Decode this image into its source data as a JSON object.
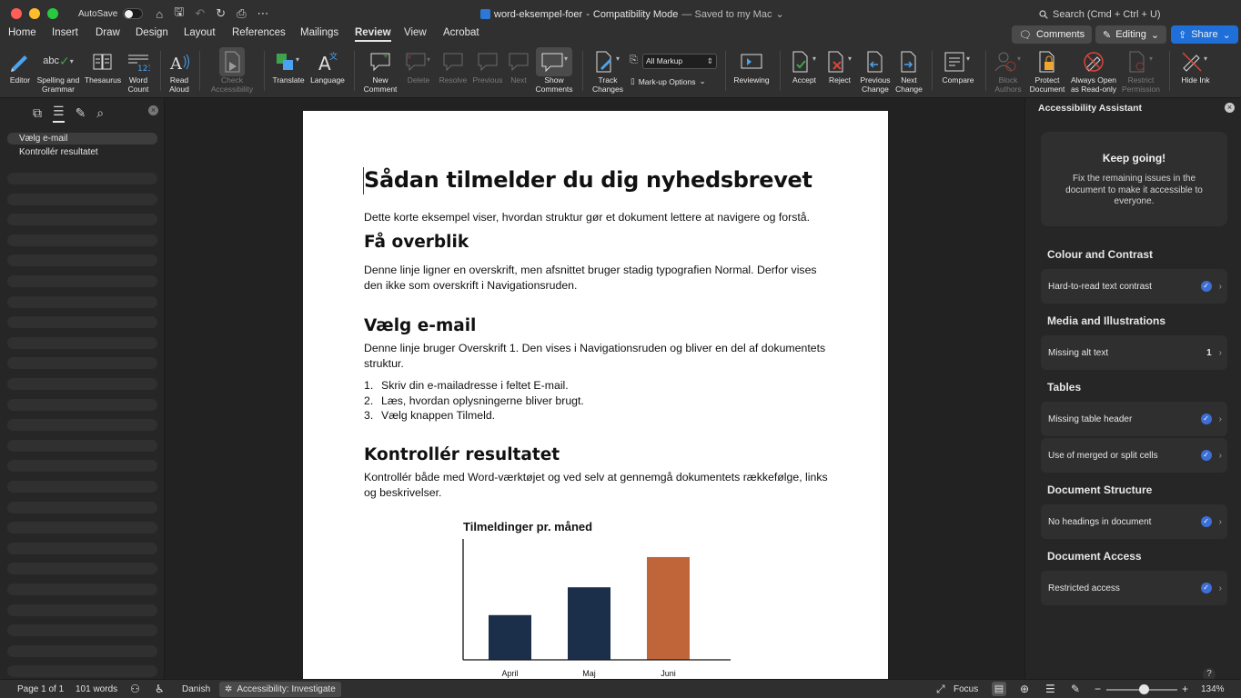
{
  "window": {
    "autosave_label": "AutoSave",
    "doc_name": "word-eksempel-foer",
    "mode": "Compatibility Mode",
    "saved": "— Saved to my Mac",
    "search_placeholder": "Search (Cmd + Ctrl + U)"
  },
  "menu": {
    "tabs": [
      "Home",
      "Insert",
      "Draw",
      "Design",
      "Layout",
      "References",
      "Mailings",
      "Review",
      "View",
      "Acrobat"
    ],
    "active_tab": "Review",
    "comments_label": "Comments",
    "editing_label": "Editing",
    "share_label": "Share"
  },
  "ribbon": {
    "editor": "Editor",
    "spelling": "Spelling and",
    "grammar": "Grammar",
    "thesaurus": "Thesaurus",
    "word": "Word",
    "count": "Count",
    "read": "Read",
    "aloud": "Aloud",
    "check": "Check",
    "accessibility": "Accessibility",
    "translate": "Translate",
    "language": "Language",
    "new": "New",
    "comment": "Comment",
    "delete": "Delete",
    "resolve": "Resolve",
    "previous": "Previous",
    "next": "Next",
    "show": "Show",
    "comments": "Comments",
    "track": "Track",
    "changes": "Changes",
    "all_markup": "All Markup",
    "markup_options": "Mark-up Options",
    "reviewing": "Reviewing",
    "accept": "Accept",
    "reject": "Reject",
    "previous_change_1": "Previous",
    "previous_change_2": "Change",
    "next_change_1": "Next",
    "next_change_2": "Change",
    "compare": "Compare",
    "block": "Block",
    "authors": "Authors",
    "protect": "Protect",
    "document": "Document",
    "always_open": "Always Open",
    "read_only": "as Read-only",
    "restrict": "Restrict",
    "permission": "Permission",
    "hide_ink": "Hide Ink",
    "abc": "abc"
  },
  "navigation": {
    "items": [
      "Vælg e-mail",
      "Kontrollér resultatet"
    ]
  },
  "document": {
    "title": "Sådan tilmelder du dig nyhedsbrevet",
    "intro": "Dette korte eksempel viser, hvordan struktur gør et dokument lettere at navigere og forstå.",
    "h_overblik": "Få overblik",
    "p_overblik": "Denne linje ligner en overskrift, men afsnittet bruger stadig typografien Normal. Derfor vises den ikke som overskrift i Navigationsruden.",
    "h_email": "Vælg e-mail",
    "p_email": "Denne linje bruger Overskrift 1. Den vises i Navigationsruden og bliver en del af dokumentets struktur.",
    "list": [
      {
        "n": "1.",
        "text": "Skriv din e-mailadresse i feltet E-mail."
      },
      {
        "n": "2.",
        "text": "Læs, hvordan oplysningerne bliver brugt."
      },
      {
        "n": "3.",
        "text": "Vælg knappen Tilmeld."
      }
    ],
    "h_resultat": "Kontrollér resultatet",
    "p_resultat": "Kontrollér både med Word-værktøjet og ved selv at gennemgå dokumentets rækkefølge, links og beskrivelser."
  },
  "chart_data": {
    "type": "bar",
    "title": "Tilmeldinger pr. måned",
    "categories": [
      "April",
      "Maj",
      "Juni"
    ],
    "values": [
      0.37,
      0.6,
      0.85
    ],
    "colors": [
      "#1b2e4a",
      "#1b2e4a",
      "#c0653a"
    ],
    "xlabel": "",
    "ylabel": "",
    "ylim": [
      0,
      1
    ],
    "grid": false
  },
  "assistant": {
    "title": "Accessibility Assistant",
    "keep_going": "Keep going!",
    "message": "Fix the remaining issues in the document to make it accessible to everyone.",
    "sections": [
      {
        "name": "Colour and Contrast",
        "issues": [
          {
            "label": "Hard-to-read text contrast",
            "status": "done"
          }
        ]
      },
      {
        "name": "Media and Illustrations",
        "issues": [
          {
            "label": "Missing alt text",
            "status": "count",
            "count": "1"
          }
        ]
      },
      {
        "name": "Tables",
        "issues": [
          {
            "label": "Missing table header",
            "status": "done"
          },
          {
            "label": "Use of merged or split cells",
            "status": "done"
          }
        ]
      },
      {
        "name": "Document Structure",
        "issues": [
          {
            "label": "No headings in document",
            "status": "done"
          }
        ]
      },
      {
        "name": "Document Access",
        "issues": [
          {
            "label": "Restricted access",
            "status": "done"
          }
        ]
      }
    ],
    "help": "?"
  },
  "status": {
    "page": "Page 1 of 1",
    "words": "101 words",
    "language": "Danish",
    "accessibility": "Accessibility: Investigate",
    "focus": "Focus",
    "zoom": "134%",
    "minus": "−",
    "plus": "+"
  },
  "colors": {
    "accent": "#1f6fd8",
    "bar_primary": "#1b2e4a",
    "bar_highlight": "#c0653a"
  }
}
